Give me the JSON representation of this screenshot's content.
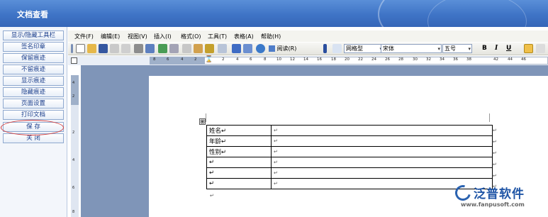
{
  "window": {
    "title": "文档查看"
  },
  "left_panel": {
    "buttons": [
      "显示/隐藏工具栏",
      "签名印章",
      "保留痕迹",
      "不留痕迹",
      "显示痕迹",
      "隐藏痕迹",
      "页面设置",
      "打印文档",
      "保 存",
      "关 闭"
    ]
  },
  "menu": [
    "文件(F)",
    "编辑(E)",
    "视图(V)",
    "插入(I)",
    "格式(O)",
    "工具(T)",
    "表格(A)",
    "帮助(H)"
  ],
  "toolbar": {
    "read_label": "阅读(R)",
    "style_label": "网格型",
    "font": "宋体",
    "size": "五号",
    "bold": "B",
    "italic": "I",
    "underline": "U"
  },
  "ruler": {
    "h_numbers": [
      "8",
      "6",
      "4",
      "2",
      "2",
      "4",
      "6",
      "8",
      "10",
      "12",
      "14",
      "16",
      "18",
      "20",
      "22",
      "24",
      "26",
      "28",
      "30",
      "32",
      "34",
      "36",
      "38",
      "42",
      "44",
      "46"
    ],
    "v_numbers": [
      "4",
      "2",
      "2",
      "4",
      "6",
      "8"
    ]
  },
  "document": {
    "rows": [
      {
        "label": "姓名↵",
        "value": "↵"
      },
      {
        "label": "年龄↵",
        "value": "↵"
      },
      {
        "label": "性别↵",
        "value": "↵"
      },
      {
        "label": "↵",
        "value": "↵"
      },
      {
        "label": "↵",
        "value": "↵"
      },
      {
        "label": "↵",
        "value": "↵"
      }
    ],
    "para_mark": "↵",
    "anchor_symbol": "⊞"
  },
  "watermark": {
    "brand": "泛普软件",
    "url": "www.fanpusoft.com"
  }
}
